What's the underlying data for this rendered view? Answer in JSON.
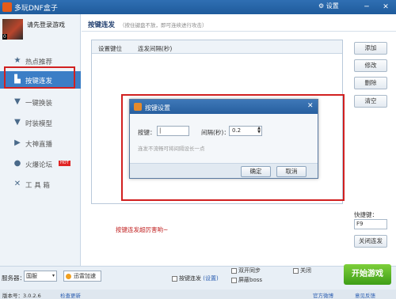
{
  "window": {
    "title": "多玩DNF盒子",
    "settings_label": "设置",
    "minimize": "─",
    "close": "✕"
  },
  "sidebar": {
    "login_text": "请先登录游戏",
    "avatar_badge": "0",
    "items": [
      {
        "label": "热点推荐",
        "icon": "star-icon"
      },
      {
        "label": "按键连发",
        "icon": "keys-icon"
      },
      {
        "label": "一键换装",
        "icon": "shirt-icon"
      },
      {
        "label": "时装模型",
        "icon": "clothes-icon"
      },
      {
        "label": "大神直播",
        "icon": "play-icon"
      },
      {
        "label": "火爆论坛",
        "icon": "chat-icon",
        "badge": "HOT"
      },
      {
        "label": "工 具 箱",
        "icon": "tools-icon"
      }
    ]
  },
  "main": {
    "tab_title": "按键连发",
    "tab_hint": "（按住键盘不放，即可连续进行攻击）",
    "table_headers": [
      "设置键位",
      "连发间隔(秒)"
    ],
    "buttons": [
      "添加",
      "修改",
      "删除",
      "清空"
    ],
    "shortcut_label": "快捷键：",
    "shortcut_value": "F9",
    "close_burst": "关闭连发",
    "promo": "按键连发超厉害哟~"
  },
  "dialog": {
    "title": "按键设置",
    "key_label": "按键：",
    "key_value": "|",
    "interval_label": "间隔(秒)：",
    "interval_value": "0.2",
    "hint": "连发不流畅可将间隔设长一点",
    "ok": "确定",
    "cancel": "取消",
    "close": "✕"
  },
  "bottom": {
    "server_label": "服务器：",
    "server_value": "国服",
    "accel_label": "迅雷加速",
    "check_burst": "按键连发",
    "check_burst_link": "(设置)",
    "check_dual": "双开同步",
    "check_boss": "屏蔽boss",
    "check_close": "关闭",
    "start": "开始游戏"
  },
  "status": {
    "version": "版本号：3.0.2.6",
    "update": "检查更新",
    "weibo": "官方微博",
    "feedback": "意见反馈"
  }
}
